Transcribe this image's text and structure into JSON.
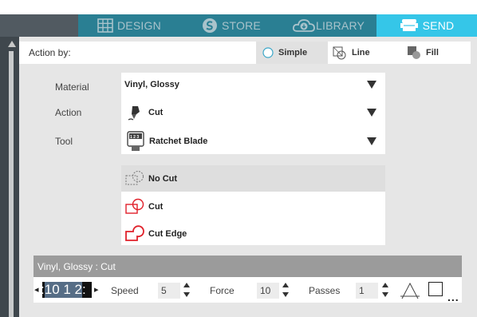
{
  "nav": {
    "tabs": [
      {
        "label": "DESIGN",
        "icon": "grid-icon"
      },
      {
        "label": "STORE",
        "icon": "silhouette-s-icon"
      },
      {
        "label": "LIBRARY",
        "icon": "cloud-library-icon"
      },
      {
        "label": "SEND",
        "icon": "send-machine-icon",
        "active": true
      }
    ]
  },
  "action_by": {
    "label": "Action by:",
    "modes": [
      {
        "label": "Simple",
        "icon": "radio-icon",
        "active": true
      },
      {
        "label": "Line",
        "icon": "line-mode-icon"
      },
      {
        "label": "Fill",
        "icon": "fill-mode-icon"
      }
    ]
  },
  "settings": {
    "material_label": "Material",
    "material_value": "Vinyl, Glossy",
    "action_label": "Action",
    "action_value": "Cut",
    "tool_label": "Tool",
    "tool_value": "Ratchet Blade"
  },
  "cut_options": [
    {
      "label": "No Cut",
      "icon": "no-cut-icon",
      "selected": true
    },
    {
      "label": "Cut",
      "icon": "cut-icon"
    },
    {
      "label": "Cut Edge",
      "icon": "cut-edge-icon"
    }
  ],
  "strip": {
    "title": "Vinyl, Glossy : Cut",
    "blade_digits": "10 1 2",
    "speed_label": "Speed",
    "speed_value": "5",
    "force_label": "Force",
    "force_value": "10",
    "passes_label": "Passes",
    "passes_value": "1",
    "more_label": "..."
  },
  "colors": {
    "accent": "#35c6e8",
    "tab_bar": "#2a7f93",
    "cut_red": "#e0202a"
  }
}
